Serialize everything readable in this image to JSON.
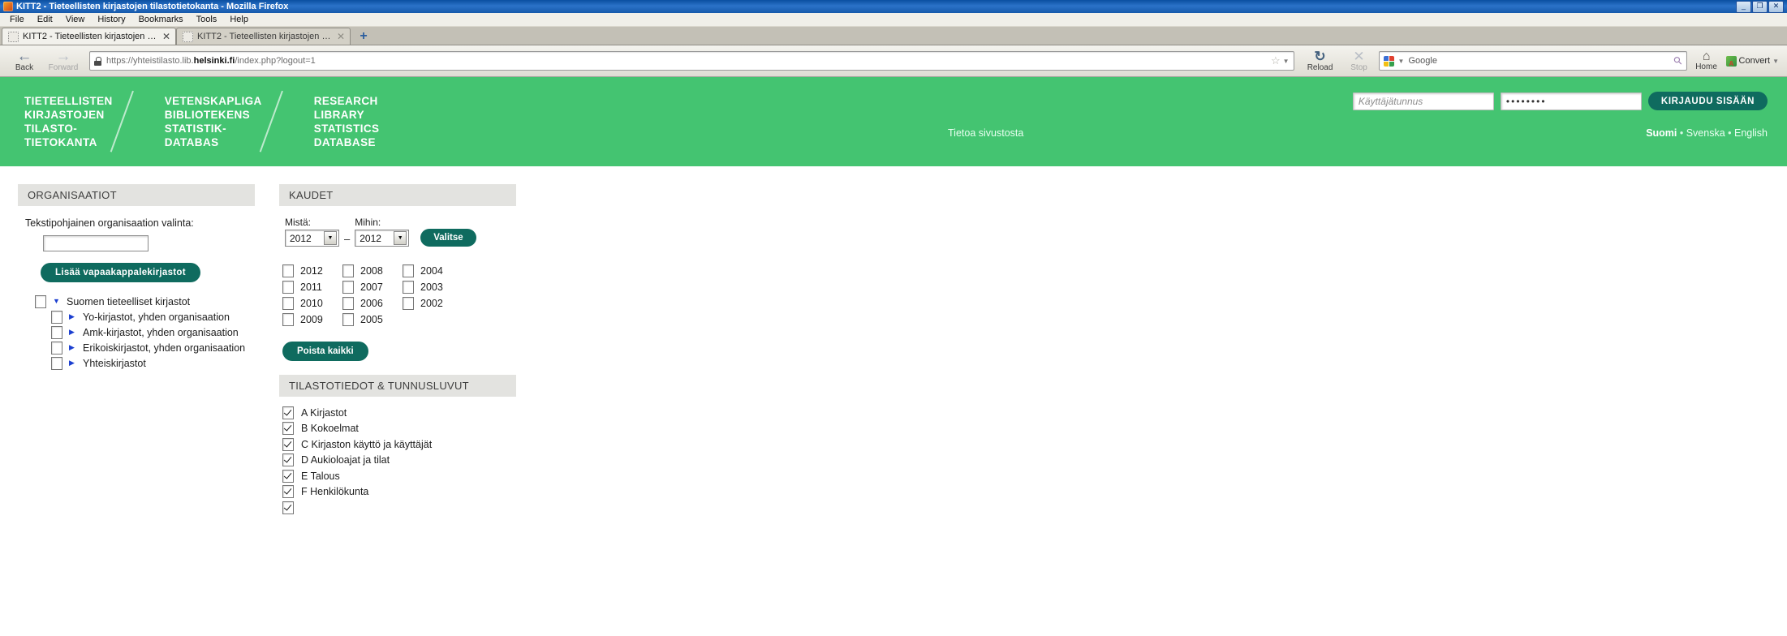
{
  "window": {
    "title": "KITT2 - Tieteellisten kirjastojen tilastotietokanta - Mozilla Firefox",
    "minimize": "_",
    "maximize": "❐",
    "close": "✕"
  },
  "menu": [
    "File",
    "Edit",
    "View",
    "History",
    "Bookmarks",
    "Tools",
    "Help"
  ],
  "tabs": [
    {
      "label": "KITT2 - Tieteellisten kirjastojen tilastotiet...",
      "close": "✕",
      "active": true
    },
    {
      "label": "KITT2 - Tieteellisten kirjastojen tilastotiet...",
      "close": "✕",
      "active": false
    }
  ],
  "newtab_label": "+",
  "toolbar": {
    "back": "Back",
    "forward": "Forward",
    "reload": "Reload",
    "stop": "Stop",
    "home": "Home",
    "convert": "Convert",
    "url_prefix": "https://yhteistilasto.lib.",
    "url_domain": "helsinki.fi",
    "url_suffix": "/index.php?logout=1",
    "search_placeholder": "Google"
  },
  "banner": {
    "color": "#44c471",
    "brand_fi": "TIETEELLISTEN\nKIRJASTOJEN\nTILASTO-\nTIETOKANTA",
    "brand_sv": "VETENSKAPLIGA\nBIBLIOTEKENS\nSTATISTIK-\nDATABAS",
    "brand_en": "RESEARCH\nLIBRARY\nSTATISTICS\nDATABASE",
    "username_placeholder": "Käyttäjätunnus",
    "username_value": "",
    "password_value": "••••••••",
    "login_button": "KIRJAUDU SISÄÄN",
    "about_link": "Tietoa sivustosta",
    "lang_fi": "Suomi",
    "lang_sv": "Svenska",
    "lang_en": "English",
    "lang_sep": "•"
  },
  "organisaatiot": {
    "title": "ORGANISAATIOT",
    "text_select_label": "Tekstipohjainen organisaation valinta:",
    "input_value": "",
    "add_button": "Lisää vapaakappalekirjastot",
    "tree": [
      {
        "label": "Suomen tieteelliset kirjastot",
        "level": 0,
        "expanded": true,
        "checked": false
      },
      {
        "label": "Yo-kirjastot, yhden organisaation",
        "level": 1,
        "expanded": false,
        "checked": false
      },
      {
        "label": "Amk-kirjastot, yhden organisaation",
        "level": 1,
        "expanded": false,
        "checked": false
      },
      {
        "label": "Erikoiskirjastot, yhden organisaation",
        "level": 1,
        "expanded": false,
        "checked": false
      },
      {
        "label": "Yhteiskirjastot",
        "level": 1,
        "expanded": false,
        "checked": false
      }
    ]
  },
  "kaudet": {
    "title": "KAUDET",
    "from_label": "Mistä:",
    "to_label": "Mihin:",
    "from_value": "2012",
    "to_value": "2012",
    "dash": "–",
    "select_button": "Valitse",
    "dropdown_glyph": "▼",
    "years_col1": [
      {
        "label": "2012",
        "checked": false
      },
      {
        "label": "2011",
        "checked": false
      },
      {
        "label": "2010",
        "checked": false
      },
      {
        "label": "2009",
        "checked": false
      }
    ],
    "years_col2": [
      {
        "label": "2008",
        "checked": false
      },
      {
        "label": "2007",
        "checked": false
      },
      {
        "label": "2006",
        "checked": false
      },
      {
        "label": "2005",
        "checked": false
      }
    ],
    "years_col3": [
      {
        "label": "2004",
        "checked": false
      },
      {
        "label": "2003",
        "checked": false
      },
      {
        "label": "2002",
        "checked": false
      }
    ],
    "clear_button": "Poista kaikki"
  },
  "tilastotiedot": {
    "title": "TILASTOTIEDOT & TUNNUSLUVUT",
    "items": [
      {
        "label": "A Kirjastot",
        "checked": true
      },
      {
        "label": "B Kokoelmat",
        "checked": true
      },
      {
        "label": "C Kirjaston käyttö ja käyttäjät",
        "checked": true
      },
      {
        "label": "D Aukioloajat ja tilat",
        "checked": true
      },
      {
        "label": "E Talous",
        "checked": true
      },
      {
        "label": "F Henkilökunta",
        "checked": true
      },
      {
        "label": "",
        "checked": true
      }
    ]
  }
}
